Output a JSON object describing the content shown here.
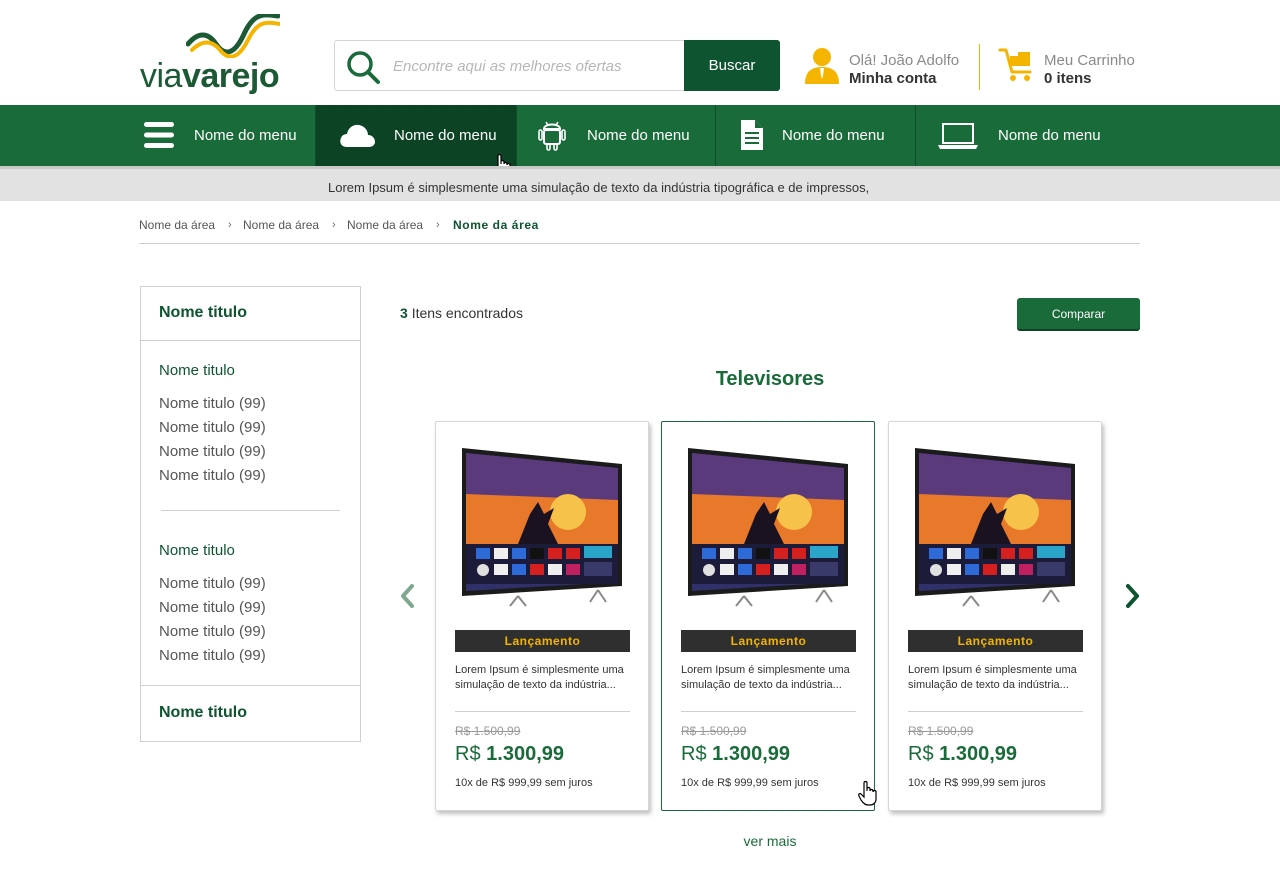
{
  "brand": {
    "via": "via",
    "varejo": "varejo",
    "primary": "#1a6b3a",
    "dark": "#0e5430",
    "accent": "#f5b400"
  },
  "search": {
    "placeholder": "Encontre aqui as melhores ofertas",
    "button": "Buscar",
    "icon": "search-icon"
  },
  "account": {
    "greeting": "Olá! João Adolfo",
    "link": "Minha conta",
    "icon": "user-icon"
  },
  "cart": {
    "label": "Meu Carrinho",
    "items": "0 itens",
    "icon": "cart-icon"
  },
  "nav": {
    "items": [
      {
        "label": "Nome do menu",
        "icon": "menu-icon"
      },
      {
        "label": "Nome do menu",
        "icon": "cloud-icon"
      },
      {
        "label": "Nome do menu",
        "icon": "android-icon"
      },
      {
        "label": "Nome do menu",
        "icon": "document-icon"
      },
      {
        "label": "Nome do menu",
        "icon": "laptop-icon"
      }
    ]
  },
  "ticker": "Lorem Ipsum é simplesmente uma simulação de texto da indústria tipográfica e de impressos,",
  "breadcrumb": [
    "Nome da área",
    "Nome da área",
    "Nome da área",
    "Nome da área"
  ],
  "sidebar": {
    "title": "Nome titulo",
    "groups": [
      {
        "title": "Nome titulo",
        "items": [
          "Nome titulo (99)",
          "Nome titulo (99)",
          "Nome titulo (99)",
          "Nome titulo (99)"
        ]
      },
      {
        "title": "Nome titulo",
        "items": [
          "Nome titulo (99)",
          "Nome titulo (99)",
          "Nome titulo (99)",
          "Nome titulo (99)"
        ]
      }
    ],
    "footer": "Nome titulo"
  },
  "results": {
    "count": "3",
    "count_label": "Itens encontrados",
    "compare": "Comparar"
  },
  "section_title": "Televisores",
  "products": [
    {
      "badge": "Lançamento",
      "desc": "Lorem Ipsum é simplesmente uma simulação de texto da indústria...",
      "old_price": "R$ 1.500,99",
      "currency": "R$",
      "price": "1.300,99",
      "installments": "10x de R$ 999,99 sem juros"
    },
    {
      "badge": "Lançamento",
      "desc": "Lorem Ipsum é simplesmente uma simulação de texto da indústria...",
      "old_price": "R$ 1.500,99",
      "currency": "R$",
      "price": "1.300,99",
      "installments": "10x de R$ 999,99 sem juros"
    },
    {
      "badge": "Lançamento",
      "desc": "Lorem Ipsum é simplesmente uma simulação de texto da indústria...",
      "old_price": "R$ 1.500,99",
      "currency": "R$",
      "price": "1.300,99",
      "installments": "10x de R$ 999,99 sem juros"
    }
  ],
  "see_more": "ver mais"
}
